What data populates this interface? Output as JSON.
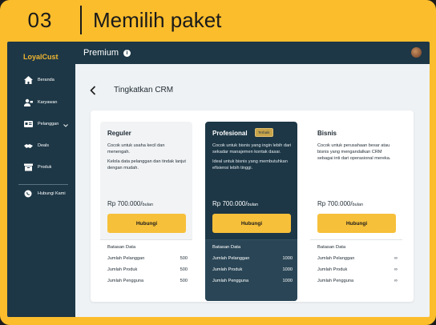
{
  "banner": {
    "number": "03",
    "title": "Memilih paket"
  },
  "sidebar": {
    "logo": "LoyalCust",
    "items": [
      {
        "label": "Beranda",
        "icon": "home-icon"
      },
      {
        "label": "Karyawan",
        "icon": "employees-icon"
      },
      {
        "label": "Pelanggan",
        "icon": "customers-icon"
      },
      {
        "label": "Deals",
        "icon": "deals-icon"
      },
      {
        "label": "Produk",
        "icon": "product-icon"
      },
      {
        "label": "Hubungi Kami",
        "icon": "whatsapp-icon"
      }
    ]
  },
  "topbar": {
    "title": "Premium"
  },
  "page": {
    "title": "Tingkatkan CRM"
  },
  "plans": [
    {
      "name": "Reguler",
      "badge": "",
      "desc1": "Cocok untuk usaha kecil dan menengah.",
      "desc2": "Kelola data pelanggan dan tindak lanjut dengan mudah.",
      "price": "Rp 700.000/",
      "unit": "bulan",
      "button": "Hubungi",
      "section": "Batasan Data",
      "features": [
        {
          "label": "Jumlah Pelanggan",
          "value": "500"
        },
        {
          "label": "Jumlah Produk",
          "value": "500"
        },
        {
          "label": "Jumlah Pengguna",
          "value": "500"
        }
      ]
    },
    {
      "name": "Profesional",
      "badge": "Terbaik",
      "desc1": "Cocok untuk bisnis yang ingin lebih dari sekadar manajemen kontak dasar.",
      "desc2": "Ideal untuk bisnis yang membutuhkan efisiensi lebih tinggi.",
      "price": "Rp 700.000/",
      "unit": "bulan",
      "button": "Hubungi",
      "section": "Batasan Data",
      "features": [
        {
          "label": "Jumlah Pelanggan",
          "value": "1000"
        },
        {
          "label": "Jumlah Produk",
          "value": "1000"
        },
        {
          "label": "Jumlah Pengguna",
          "value": "1000"
        }
      ]
    },
    {
      "name": "Bisnis",
      "badge": "",
      "desc1": "Cocok untuk perusahaan besar atau bisnis yang mengandalkan CRM sebagai inti dari operasional mereka.",
      "desc2": "",
      "price": "Rp 700.000/",
      "unit": "bulan",
      "button": "Hubungi",
      "section": "Batasan Data",
      "features": [
        {
          "label": "Jumlah Pelanggan",
          "value": "∞"
        },
        {
          "label": "Jumlah Produk",
          "value": "∞"
        },
        {
          "label": "Jumlah Pengguna",
          "value": "∞"
        }
      ]
    }
  ]
}
